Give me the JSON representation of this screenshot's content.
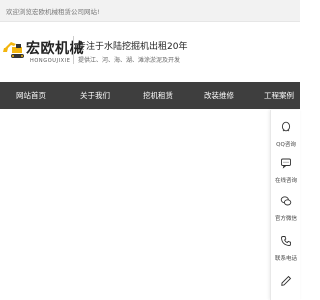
{
  "topbar": {
    "welcome": "欢迎浏览宏欧机械租赁公司网站!"
  },
  "header": {
    "brand_cn": "宏欧机械",
    "brand_en": "HONGOUJIXIE",
    "slogan": "专注于水陆挖掘机出租20年",
    "slogan_sub": "提供江、河、海、湖、滩涂淤泥及开发"
  },
  "nav": {
    "items": [
      {
        "label": "网站首页"
      },
      {
        "label": "关于我们"
      },
      {
        "label": "挖机租赁"
      },
      {
        "label": "改装维修"
      },
      {
        "label": "工程案例"
      }
    ]
  },
  "float_bar": {
    "items": [
      {
        "label": "QQ咨询",
        "icon": "qq-icon"
      },
      {
        "label": "在线咨询",
        "icon": "chat-icon"
      },
      {
        "label": "官方微信",
        "icon": "wechat-icon"
      },
      {
        "label": "联系电话",
        "icon": "phone-icon"
      },
      {
        "label": "",
        "icon": "edit-icon"
      }
    ]
  },
  "colors": {
    "nav_bg": "#3e3e3e",
    "logo_yellow": "#f2b50f",
    "topbar_bg": "#f2f2f2"
  }
}
